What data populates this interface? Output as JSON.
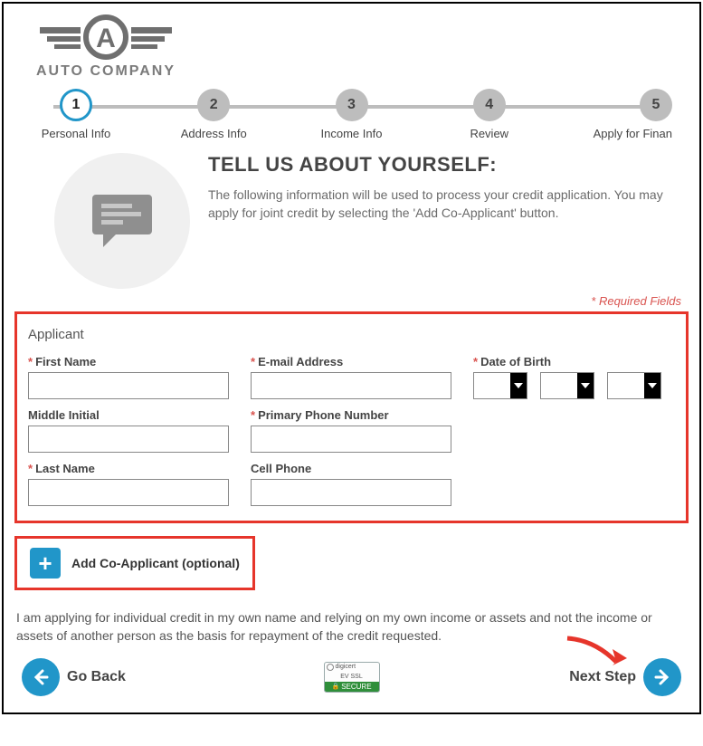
{
  "brand": {
    "name": "AUTO COMPANY"
  },
  "stepper": {
    "steps": [
      {
        "num": "1",
        "label": "Personal Info",
        "active": true
      },
      {
        "num": "2",
        "label": "Address Info",
        "active": false
      },
      {
        "num": "3",
        "label": "Income Info",
        "active": false
      },
      {
        "num": "4",
        "label": "Review",
        "active": false
      },
      {
        "num": "5",
        "label": "Apply for Finan",
        "active": false
      }
    ]
  },
  "intro": {
    "heading": "TELL US ABOUT YOURSELF:",
    "body": "The following information will be used to process your credit application. You may apply for joint credit by selecting the 'Add Co-Applicant' button."
  },
  "required_note": "* Required Fields",
  "form": {
    "section_title": "Applicant",
    "fields": {
      "first_name": {
        "label": "First Name",
        "value": "",
        "required": true
      },
      "middle_initial": {
        "label": "Middle Initial",
        "value": "",
        "required": false
      },
      "last_name": {
        "label": "Last Name",
        "value": "",
        "required": true
      },
      "email": {
        "label": "E-mail Address",
        "value": "",
        "required": true
      },
      "primary_phone": {
        "label": "Primary Phone Number",
        "value": "",
        "required": true
      },
      "cell_phone": {
        "label": "Cell Phone",
        "value": "",
        "required": false
      },
      "dob": {
        "label": "Date of Birth",
        "required": true,
        "month": "",
        "day": "",
        "year": ""
      }
    }
  },
  "coapplicant": {
    "label": "Add Co-Applicant (optional)"
  },
  "disclosure": "I am applying for individual credit in my own name and relying on my own income or assets and not the income or assets of another person as the basis for repayment of the credit requested.",
  "footer": {
    "back_label": "Go Back",
    "next_label": "Next Step",
    "seal": {
      "brand": "digicert",
      "line2": "EV SSL",
      "secure": "SECURE"
    }
  }
}
